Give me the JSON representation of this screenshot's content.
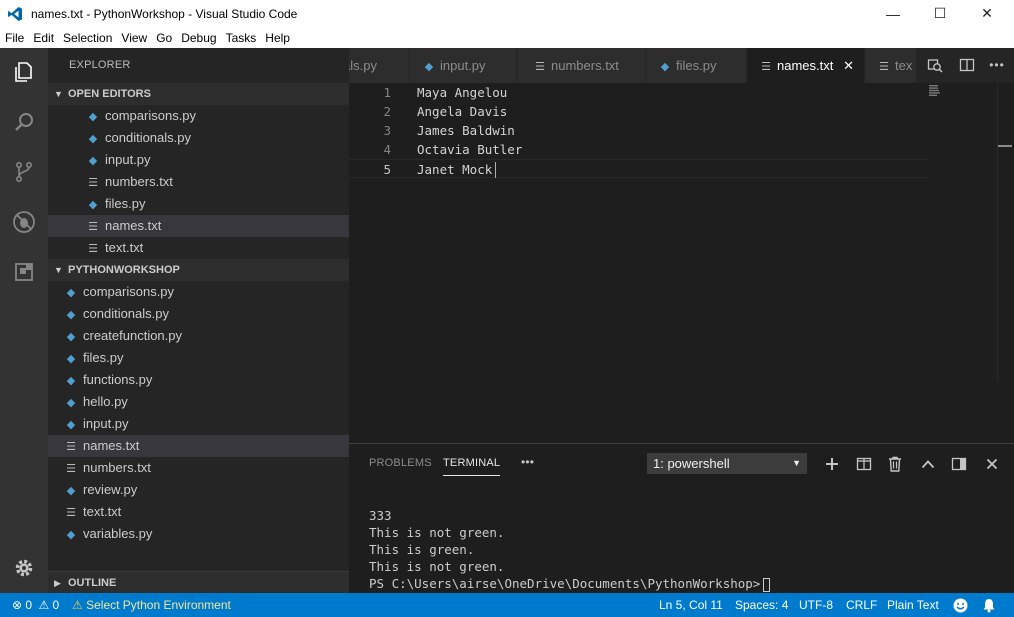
{
  "window": {
    "title": "names.txt - PythonWorkshop - Visual Studio Code",
    "minimize": "—",
    "maximize": "☐",
    "close": "✕"
  },
  "menu": [
    "File",
    "Edit",
    "Selection",
    "View",
    "Go",
    "Debug",
    "Tasks",
    "Help"
  ],
  "sidebar": {
    "title": "EXPLORER",
    "open_editors": {
      "header": "OPEN EDITORS",
      "items": [
        {
          "name": "comparisons.py",
          "type": "py"
        },
        {
          "name": "conditionals.py",
          "type": "py"
        },
        {
          "name": "input.py",
          "type": "py"
        },
        {
          "name": "numbers.txt",
          "type": "txt"
        },
        {
          "name": "files.py",
          "type": "py"
        },
        {
          "name": "names.txt",
          "type": "txt",
          "selected": true
        },
        {
          "name": "text.txt",
          "type": "txt"
        }
      ]
    },
    "workspace": {
      "header": "PYTHONWORKSHOP",
      "items": [
        {
          "name": "comparisons.py",
          "type": "py"
        },
        {
          "name": "conditionals.py",
          "type": "py"
        },
        {
          "name": "createfunction.py",
          "type": "py"
        },
        {
          "name": "files.py",
          "type": "py"
        },
        {
          "name": "functions.py",
          "type": "py"
        },
        {
          "name": "hello.py",
          "type": "py"
        },
        {
          "name": "input.py",
          "type": "py"
        },
        {
          "name": "names.txt",
          "type": "txt",
          "selected": true
        },
        {
          "name": "numbers.txt",
          "type": "txt"
        },
        {
          "name": "review.py",
          "type": "py"
        },
        {
          "name": "text.txt",
          "type": "txt"
        },
        {
          "name": "variables.py",
          "type": "py"
        }
      ]
    },
    "outline": {
      "header": "OUTLINE"
    }
  },
  "tabs": [
    {
      "label": "als.py",
      "type": "py-cut"
    },
    {
      "label": "input.py",
      "type": "py"
    },
    {
      "label": "numbers.txt",
      "type": "txt"
    },
    {
      "label": "files.py",
      "type": "py"
    },
    {
      "label": "names.txt",
      "type": "txt",
      "active": true,
      "close": "✕"
    },
    {
      "label": "tex",
      "type": "txt"
    }
  ],
  "editor": {
    "lines": [
      {
        "num": "1",
        "text": "Maya Angelou"
      },
      {
        "num": "2",
        "text": "Angela Davis"
      },
      {
        "num": "3",
        "text": "James Baldwin"
      },
      {
        "num": "4",
        "text": "Octavia Butler"
      },
      {
        "num": "5",
        "text": "Janet Mock"
      }
    ]
  },
  "panel": {
    "tabs": [
      "PROBLEMS",
      "TERMINAL"
    ],
    "more": "•••",
    "terminal_select": "1: powershell",
    "terminal_lines": [
      "333",
      "This is not green.",
      "This is green.",
      "This is not green.",
      "PS C:\\Users\\airse\\OneDrive\\Documents\\PythonWorkshop>"
    ]
  },
  "statusbar": {
    "errors": "0",
    "warnings": "0",
    "python_env": "Select Python Environment",
    "position": "Ln 5, Col 11",
    "spaces": "Spaces: 4",
    "encoding": "UTF-8",
    "eol": "CRLF",
    "language": "Plain Text"
  },
  "colors": {
    "accent": "#007acc",
    "python_icon": "#4f9fcf",
    "selected_item": "#37373d",
    "warning": "#f2c94c"
  }
}
